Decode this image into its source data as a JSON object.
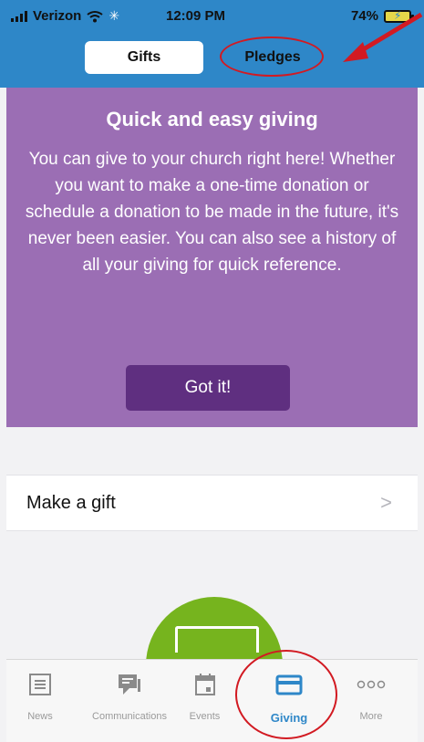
{
  "status_bar": {
    "carrier": "Verizon",
    "time": "12:09 PM",
    "battery": "74%"
  },
  "segments": [
    {
      "label": "Gifts",
      "selected": true
    },
    {
      "label": "Pledges",
      "selected": false
    }
  ],
  "card": {
    "title": "Quick and easy giving",
    "body": "You can give to your church right here! Whether you want to make a one-time donation or schedule a donation to be made in the future, it's never been easier. You can also see a history of all your giving for quick reference.",
    "button": "Got it!",
    "background": "#9b6eb4",
    "button_color": "#5f2f80"
  },
  "list": {
    "make_gift": "Make a gift",
    "chevron": ">"
  },
  "tabs": [
    {
      "label": "News",
      "icon": "news-icon"
    },
    {
      "label": "Communications",
      "icon": "chat-icon"
    },
    {
      "label": "Events",
      "icon": "calendar-icon"
    },
    {
      "label": "Giving",
      "icon": "card-icon",
      "active": true
    },
    {
      "label": "More",
      "icon": "more-dots-icon"
    }
  ],
  "colors": {
    "header": "#2e87c8",
    "annotation": "#d21a22",
    "green": "#76b41e"
  }
}
